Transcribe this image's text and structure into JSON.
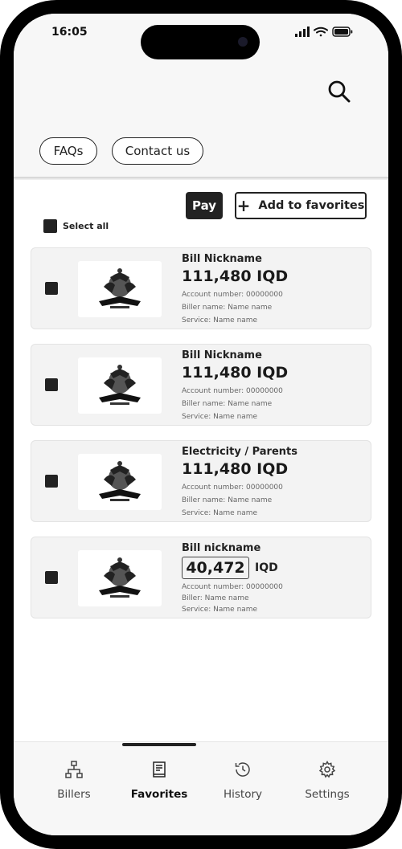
{
  "status_bar": {
    "time": "16:05"
  },
  "header": {
    "faqs_label": "FAQs",
    "contact_label": "Contact us"
  },
  "actions": {
    "pay_label": "Pay",
    "add_favorites_label": "Add to favorites",
    "select_all_label": "Select all"
  },
  "bills": [
    {
      "nickname": "Bill Nickname",
      "amount": "111,480 IQD",
      "account": "Account number: 00000000",
      "biller": "Biller name: Name name",
      "service": "Service: Name name"
    },
    {
      "nickname": "Bill Nickname",
      "amount": "111,480 IQD",
      "account": "Account number: 00000000",
      "biller": "Biller name: Name name",
      "service": "Service: Name name"
    },
    {
      "nickname": "Electricity / Parents",
      "amount": "111,480 IQD",
      "account": "Account number: 00000000",
      "biller": "Biller name: Name name",
      "service": "Service: Name name"
    },
    {
      "nickname": "Bill nickname",
      "amount_value": "40,472",
      "currency": "IQD",
      "account": "Account number: 00000000",
      "biller": "Biller: Name name",
      "service": "Service: Name name"
    }
  ],
  "nav": {
    "items": [
      {
        "label": "Billers",
        "icon": "sitemap-icon"
      },
      {
        "label": "Favorites",
        "icon": "receipt-icon",
        "active": true
      },
      {
        "label": "History",
        "icon": "history-icon"
      },
      {
        "label": "Settings",
        "icon": "gear-icon"
      }
    ]
  },
  "colors": {
    "primary": "#222222",
    "card_bg": "#f3f3f3",
    "header_bg": "#f7f7f7"
  }
}
